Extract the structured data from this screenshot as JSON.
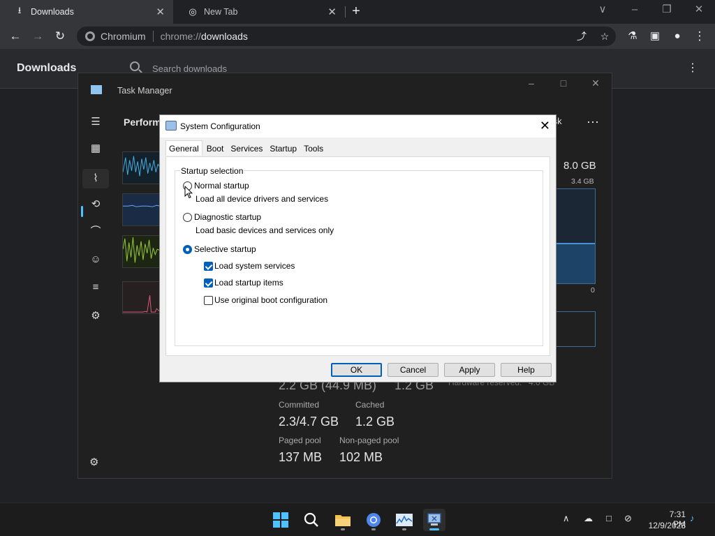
{
  "browser": {
    "tabs": [
      {
        "label": "Downloads",
        "active": true
      },
      {
        "label": "New Tab",
        "active": false
      }
    ],
    "omnibox": {
      "origin": "Chromium",
      "scheme": "chrome://",
      "host": "downloads"
    },
    "downloads_title": "Downloads",
    "search_placeholder": "Search downloads"
  },
  "task_manager": {
    "title": "Task Manager",
    "heading": "Perform",
    "run_task": "sk",
    "memory_total": "8.0 GB",
    "memory_in_use": "3.4 GB",
    "graph_min": "0",
    "memory_fill_percent": 43,
    "stats": {
      "in_use_value": "2.2 GB (44.9 MB)",
      "available_value": "1.2 GB",
      "hardware_reserved_label": "Hardware reserved:",
      "hardware_reserved_value": "4.0 GB",
      "committed_label": "Committed",
      "committed_value": "2.3/4.7 GB",
      "cached_label": "Cached",
      "cached_value": "1.2 GB",
      "paged_label": "Paged pool",
      "paged_value": "137 MB",
      "nonpaged_label": "Non-paged pool",
      "nonpaged_value": "102 MB"
    }
  },
  "dialog": {
    "title": "System Configuration",
    "tabs": [
      "General",
      "Boot",
      "Services",
      "Startup",
      "Tools"
    ],
    "active_tab": "General",
    "group_label": "Startup selection",
    "normal_startup": "Normal startup",
    "normal_desc": "Load all device drivers and services",
    "diagnostic_startup": "Diagnostic startup",
    "diagnostic_desc": "Load basic devices and services only",
    "selective_startup": "Selective startup",
    "load_system_services": "Load system services",
    "load_startup_items": "Load startup items",
    "use_original_boot": "Use original boot configuration",
    "buttons": {
      "ok": "OK",
      "cancel": "Cancel",
      "apply": "Apply",
      "help": "Help"
    }
  },
  "taskbar": {
    "time": "7:31 PM",
    "date": "12/9/2023"
  },
  "colors": {
    "accent": "#005fb8",
    "taskbar_accent": "#4cc2ff",
    "memory_line": "#4a90d9"
  }
}
